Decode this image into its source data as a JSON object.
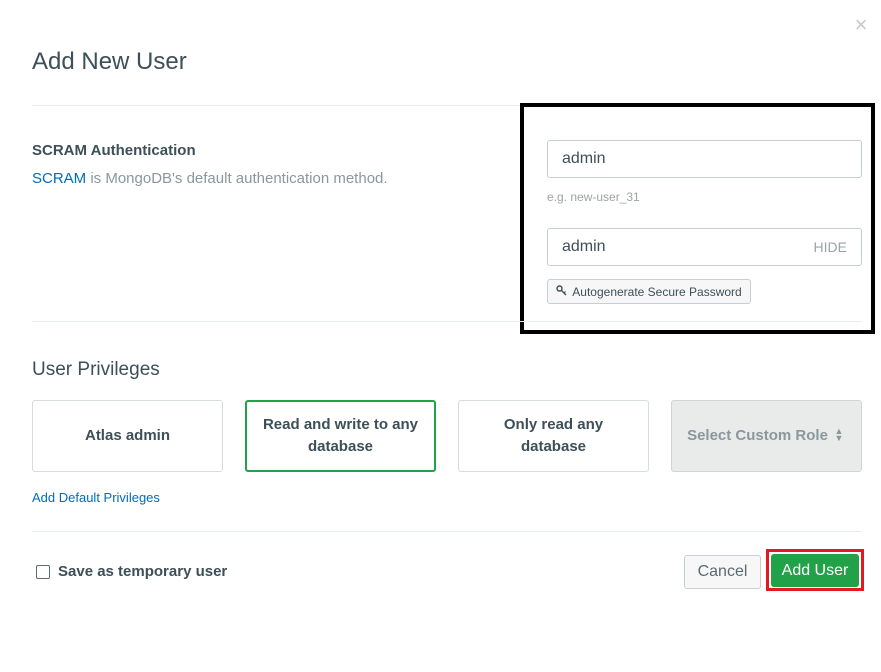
{
  "modal": {
    "title": "Add New User",
    "close_icon": "close-icon"
  },
  "auth": {
    "heading": "SCRAM Authentication",
    "link_text": "SCRAM",
    "desc_rest": " is MongoDB's default authentication method."
  },
  "username": {
    "value": "admin",
    "hint": "e.g. new-user_31"
  },
  "password": {
    "value": "admin",
    "toggle_label": "HIDE"
  },
  "autogenerate": {
    "icon": "key-icon",
    "label": "Autogenerate Secure Password"
  },
  "privileges": {
    "heading": "User Privileges",
    "roles": [
      {
        "label": "Atlas admin",
        "selected": false
      },
      {
        "label": "Read and write to any database",
        "selected": true
      },
      {
        "label": "Only read any database",
        "selected": false
      },
      {
        "label": "Select Custom Role",
        "selected": false,
        "icon": "up-down-caret-icon"
      }
    ],
    "add_default_link": "Add Default Privileges"
  },
  "temporary": {
    "label": "Save as temporary user",
    "checked": false
  },
  "footer": {
    "cancel_label": "Cancel",
    "add_label": "Add User"
  },
  "colors": {
    "accent_green": "#21a148",
    "link_blue": "#006cbc",
    "highlight_black": "#000000",
    "highlight_red": "#e21b23"
  }
}
